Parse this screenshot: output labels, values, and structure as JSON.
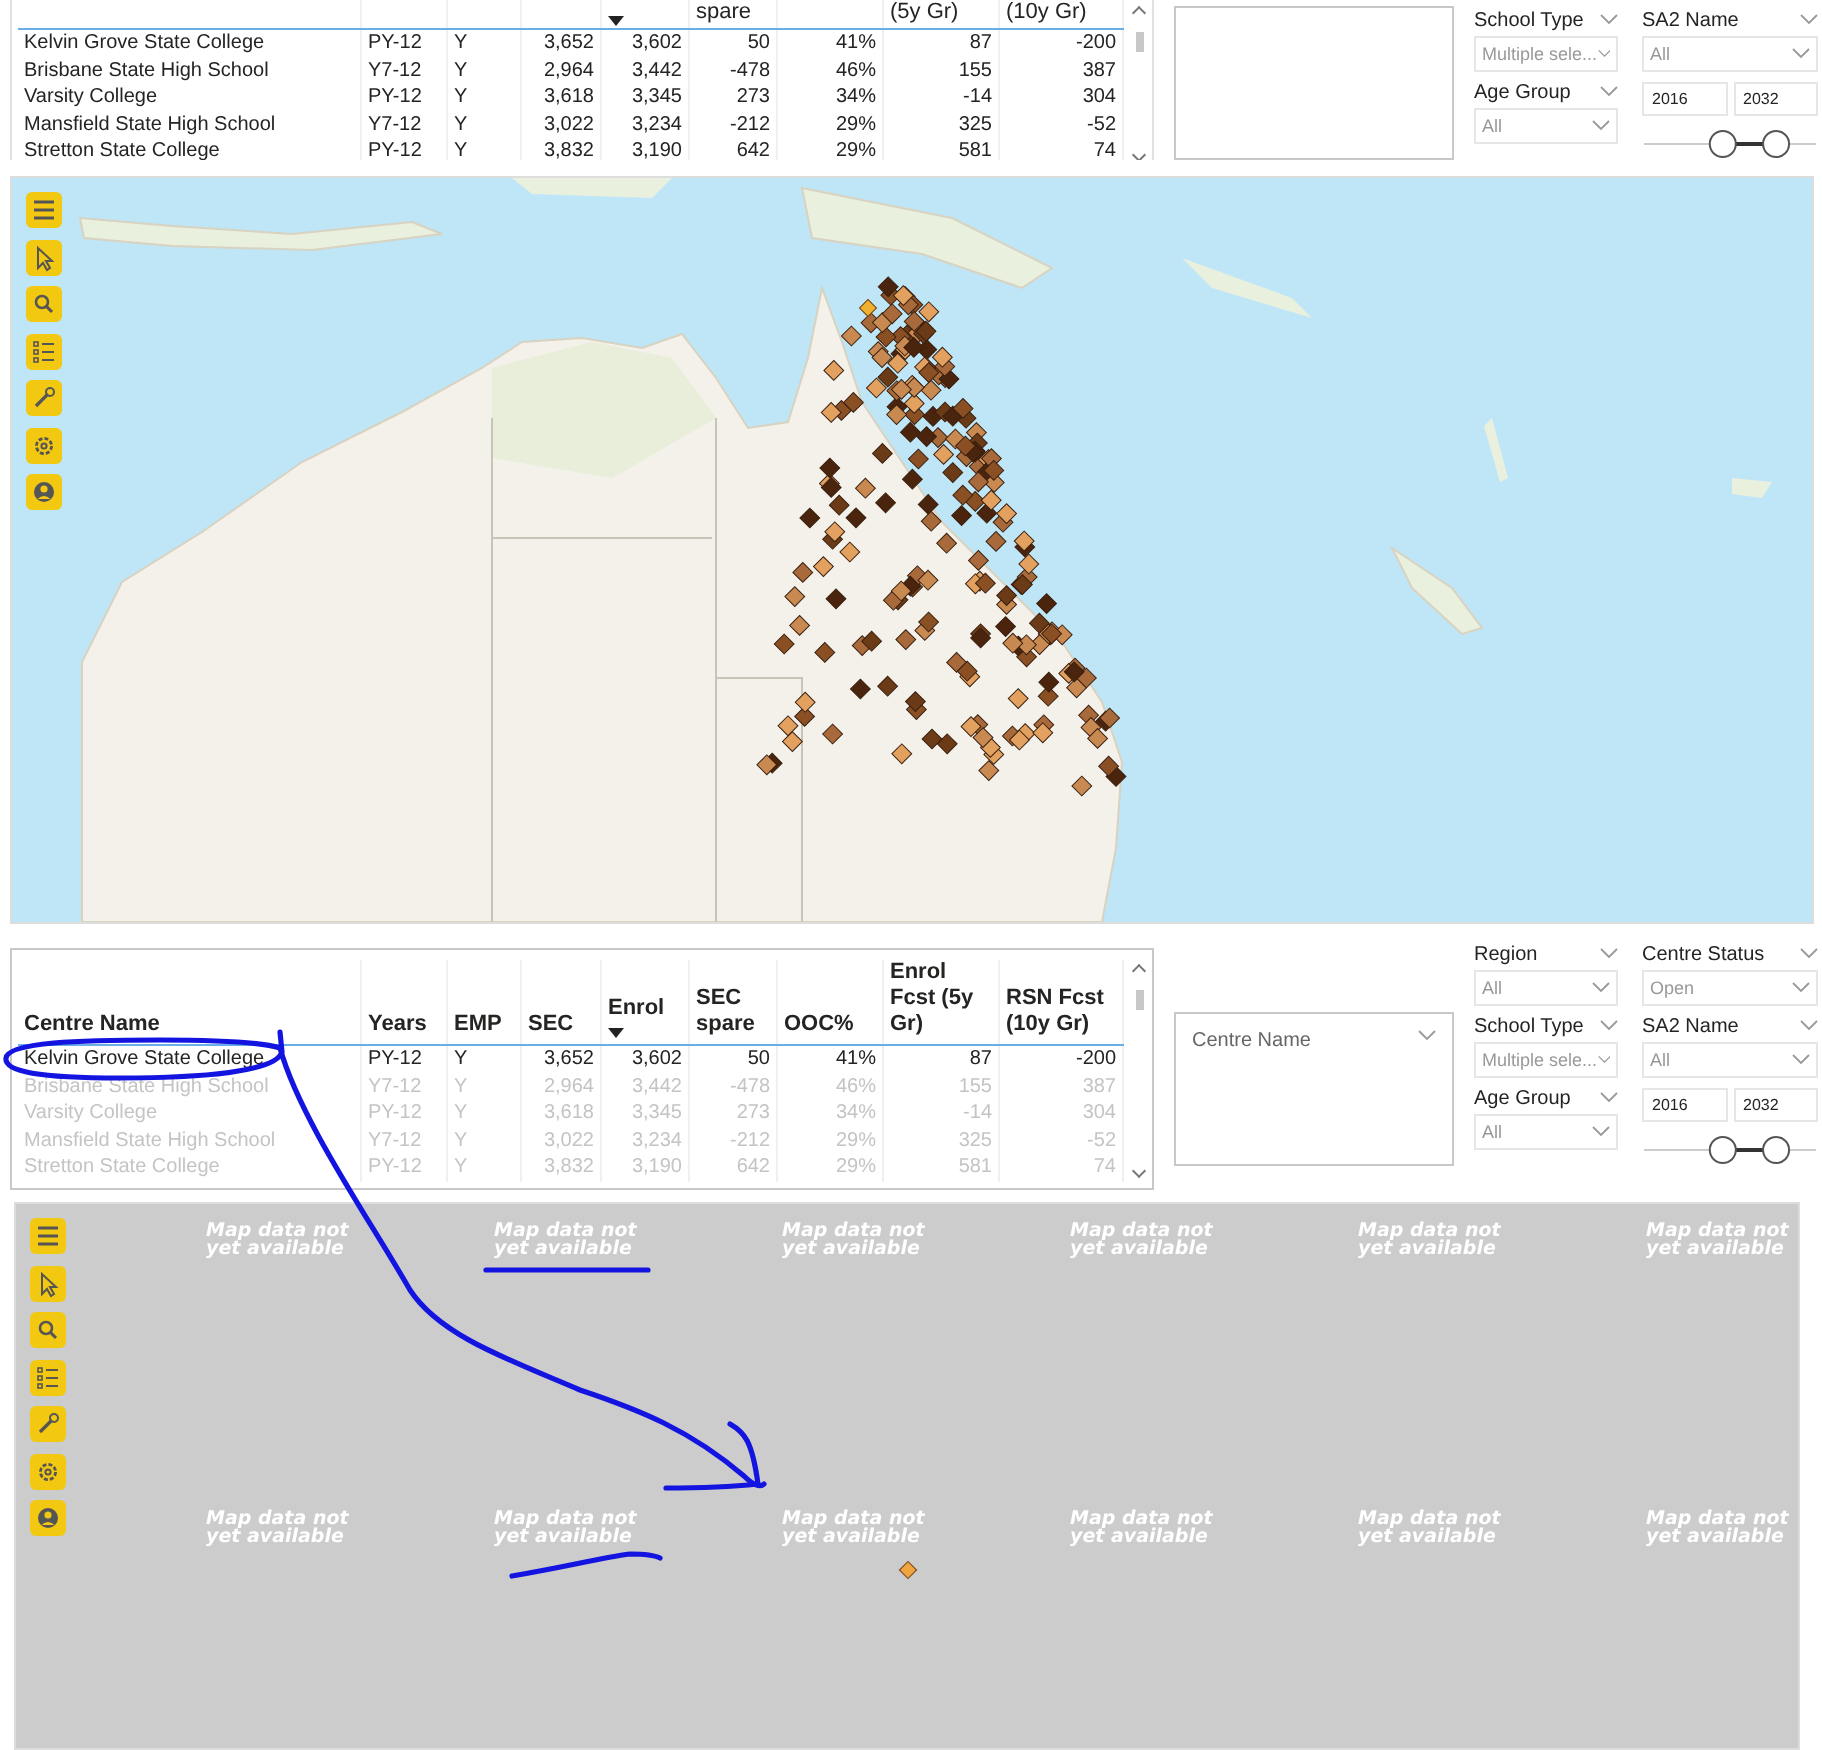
{
  "top_panel": {
    "table": {
      "columns": [
        {},
        {},
        {},
        {},
        {
          "sorted": true
        },
        {
          "label": "spare"
        },
        {},
        {
          "label": "(5y Gr)"
        },
        {
          "label": "(10y Gr)"
        }
      ],
      "rows": [
        {
          "cells": [
            "Kelvin Grove State College",
            "PY-12",
            "Y",
            "3,652",
            "3,602",
            "50",
            "41%",
            "87",
            "-200"
          ]
        },
        {
          "cells": [
            "Brisbane State High School",
            "Y7-12",
            "Y",
            "2,964",
            "3,442",
            "-478",
            "46%",
            "155",
            "387"
          ]
        },
        {
          "cells": [
            "Varsity College",
            "PY-12",
            "Y",
            "3,618",
            "3,345",
            "273",
            "34%",
            "-14",
            "304"
          ]
        },
        {
          "cells": [
            "Mansfield State High School",
            "Y7-12",
            "Y",
            "3,022",
            "3,234",
            "-212",
            "29%",
            "325",
            "-52"
          ]
        },
        {
          "cells": [
            "Stretton State College",
            "PY-12",
            "Y",
            "3,832",
            "3,190",
            "642",
            "29%",
            "581",
            "74"
          ]
        }
      ]
    },
    "slicers": {
      "dropdowns": [
        {
          "label": "School Type",
          "value": "Multiple sele..."
        },
        {
          "label": "SA2 Name",
          "value": "All"
        },
        {
          "label": "Age Group",
          "value": "All"
        }
      ],
      "range": {
        "from": "2016",
        "to": "2032",
        "thumbs": [
          {
            "level": 0.45
          },
          {
            "level": 0.82
          }
        ]
      }
    },
    "map": {
      "kind": "basemap"
    }
  },
  "bottom_panel": {
    "table": {
      "columns": [
        {
          "label": "Centre Name"
        },
        {
          "label": "Years"
        },
        {
          "label": "EMP"
        },
        {
          "label": "SEC"
        },
        {
          "label": "Enrol",
          "sorted": true
        },
        {
          "label": "SEC spare"
        },
        {
          "label": "OOC%"
        },
        {
          "label": "Enrol Fcst (5y Gr)"
        },
        {
          "label": "RSN Fcst (10y Gr)"
        }
      ],
      "rows": [
        {
          "selected": true,
          "cells": [
            "Kelvin Grove State College",
            "PY-12",
            "Y",
            "3,652",
            "3,602",
            "50",
            "41%",
            "87",
            "-200"
          ]
        },
        {
          "selected": false,
          "cells": [
            "Brisbane State High School",
            "Y7-12",
            "Y",
            "2,964",
            "3,442",
            "-478",
            "46%",
            "155",
            "387"
          ]
        },
        {
          "selected": false,
          "cells": [
            "Varsity College",
            "PY-12",
            "Y",
            "3,618",
            "3,345",
            "273",
            "34%",
            "-14",
            "304"
          ]
        },
        {
          "selected": false,
          "cells": [
            "Mansfield State High School",
            "Y7-12",
            "Y",
            "3,022",
            "3,234",
            "-212",
            "29%",
            "325",
            "-52"
          ]
        },
        {
          "selected": false,
          "cells": [
            "Stretton State College",
            "PY-12",
            "Y",
            "3,832",
            "3,190",
            "642",
            "29%",
            "581",
            "74"
          ]
        }
      ]
    },
    "slicers": {
      "list_box": {
        "title": "Centre Name"
      },
      "dropdowns": [
        {
          "label": "Region",
          "value": "All"
        },
        {
          "label": "Centre Status",
          "value": "Open"
        },
        {
          "label": "School Type",
          "value": "Multiple sele..."
        },
        {
          "label": "SA2 Name",
          "value": "All"
        },
        {
          "label": "Age Group",
          "value": "All"
        }
      ],
      "range": {
        "from": "2016",
        "to": "2032",
        "thumbs": [
          {
            "level": 0.45
          },
          {
            "level": 0.82
          }
        ]
      }
    },
    "map": {
      "kind": "no-data",
      "tile_messages": [
        "Map data not yet available",
        "Map data not yet available",
        "Map data not yet available",
        "Map data not yet available",
        "Map data not yet available",
        "Map data not yet available",
        "Map data not yet available",
        "Map data not yet available",
        "Map data not yet available",
        "Map data not yet available",
        "Map data not yet available",
        "Map data not yet available"
      ]
    }
  }
}
